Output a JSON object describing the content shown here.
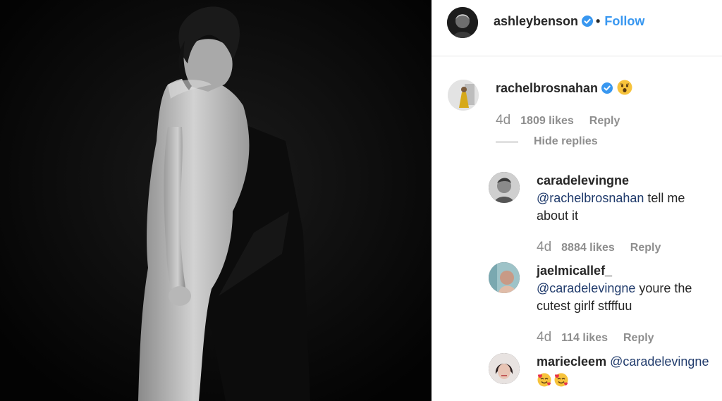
{
  "post": {
    "author": "ashleybenson",
    "follow_label": "Follow",
    "separator": "•"
  },
  "comments": [
    {
      "username": "rachelbrosnahan",
      "verified": true,
      "emoji": "surprised-face-emoji",
      "age": "4d",
      "likes": "1809 likes",
      "reply_label": "Reply",
      "hide_replies_label": "Hide replies"
    },
    {
      "username": "caradelevingne",
      "mention": "@rachelbrosnahan",
      "text_line1": " tell me",
      "text_line2": "about it",
      "age": "4d",
      "likes": "8884 likes",
      "reply_label": "Reply"
    },
    {
      "username": "jaelmicallef_",
      "mention": "@caradelevingne",
      "text_line1": " youre the",
      "text_line2": "cutest girlf stfffuu",
      "age": "4d",
      "likes": "114 likes",
      "reply_label": "Reply"
    },
    {
      "username": "mariecleem",
      "mention": "@caradelevingne",
      "emoji": "smiling-face-with-hearts-emoji"
    }
  ],
  "colors": {
    "link_blue": "#3897f0",
    "verified_blue": "#3897f0",
    "mention_navy": "#1f3a6b",
    "meta_gray": "#8e8e8e",
    "photo_background": "#050505"
  }
}
